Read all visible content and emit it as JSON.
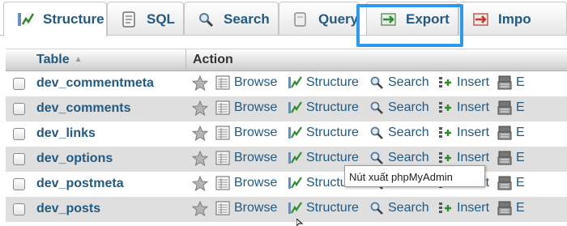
{
  "tabs": [
    {
      "label": "Structure",
      "icon": "structure-icon"
    },
    {
      "label": "SQL",
      "icon": "sql-icon"
    },
    {
      "label": "Search",
      "icon": "search-icon"
    },
    {
      "label": "Query",
      "icon": "query-icon"
    },
    {
      "label": "Export",
      "icon": "export-icon"
    },
    {
      "label": "Impo",
      "icon": "import-icon"
    }
  ],
  "table": {
    "header_table": "Table",
    "header_action": "Action",
    "actions": {
      "browse": "Browse",
      "structure": "Structure",
      "search": "Search",
      "insert": "Insert",
      "empty": "E"
    },
    "rows": [
      "dev_commentmeta",
      "dev_comments",
      "dev_links",
      "dev_options",
      "dev_postmeta",
      "dev_posts"
    ]
  },
  "tooltip": "Nút xuất phpMyAdmin",
  "colors": {
    "link": "#235a81",
    "highlight": "#2e9bea",
    "row_alt": "#dfdfdf"
  }
}
